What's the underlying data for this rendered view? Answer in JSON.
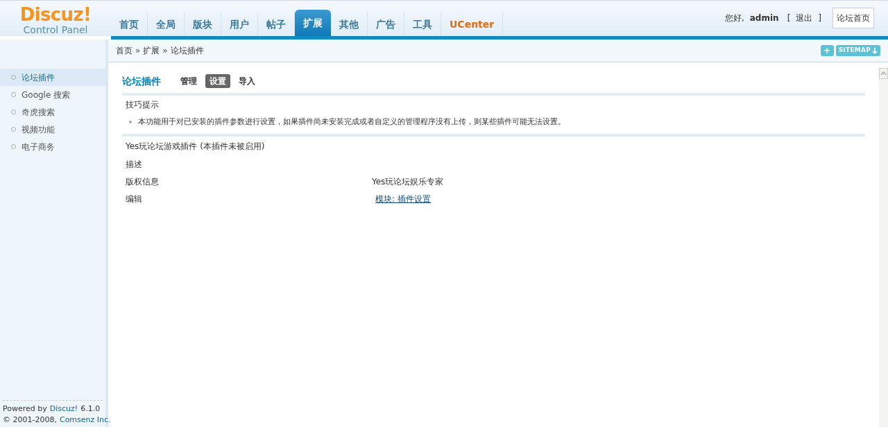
{
  "logo": {
    "name": "Discuz!",
    "subtitle": "Control Panel"
  },
  "nav": [
    {
      "label": "首页",
      "selected": false,
      "kind": "normal"
    },
    {
      "label": "全局",
      "selected": false,
      "kind": "normal"
    },
    {
      "label": "版块",
      "selected": false,
      "kind": "normal"
    },
    {
      "label": "用户",
      "selected": false,
      "kind": "normal"
    },
    {
      "label": "帖子",
      "selected": false,
      "kind": "normal"
    },
    {
      "label": "扩展",
      "selected": true,
      "kind": "normal"
    },
    {
      "label": "其他",
      "selected": false,
      "kind": "normal"
    },
    {
      "label": "广告",
      "selected": false,
      "kind": "normal"
    },
    {
      "label": "工具",
      "selected": false,
      "kind": "normal"
    },
    {
      "label": "UCenter",
      "selected": false,
      "kind": "external"
    }
  ],
  "user": {
    "greeting": "您好,",
    "name": "admin",
    "logout_open": "[",
    "logout": "退出",
    "logout_close": "]"
  },
  "forum_home": "论坛首页",
  "breadcrumb": {
    "items": [
      "首页",
      "扩展",
      "论坛插件"
    ],
    "separator": "»"
  },
  "shortcut_add": "+",
  "sitemap": "SITEMAP",
  "sidebar": [
    {
      "label": "论坛插件",
      "selected": true
    },
    {
      "label": "Google 搜索",
      "selected": false
    },
    {
      "label": "奇虎搜索",
      "selected": false
    },
    {
      "label": "视频功能",
      "selected": false
    },
    {
      "label": "电子商务",
      "selected": false
    }
  ],
  "footer": [
    {
      "text": "Powered by",
      "link": "Discuz!",
      "suffix": "6.1.0"
    },
    {
      "text": "© 2001-2008,",
      "link": "Comsenz Inc."
    }
  ],
  "page_title": "论坛插件",
  "tabs": [
    {
      "label": "管理",
      "selected": false
    },
    {
      "label": "设置",
      "selected": true
    },
    {
      "label": "导入",
      "selected": false
    }
  ],
  "tips": {
    "title": "技巧提示",
    "items": [
      "本功能用于对已安装的插件参数进行设置，如果插件尚未安装完成或者自定义的管理程序没有上传，则某些插件可能无法设置。"
    ]
  },
  "plugin": {
    "title": "Yes玩论坛游戏插件 (本插件未被启用)",
    "rows": [
      {
        "label": "描述"
      },
      {
        "label": "版权信息",
        "value": "Yes玩论坛娱乐专家"
      },
      {
        "label": "编辑",
        "link": "模块: 插件设置"
      }
    ]
  }
}
